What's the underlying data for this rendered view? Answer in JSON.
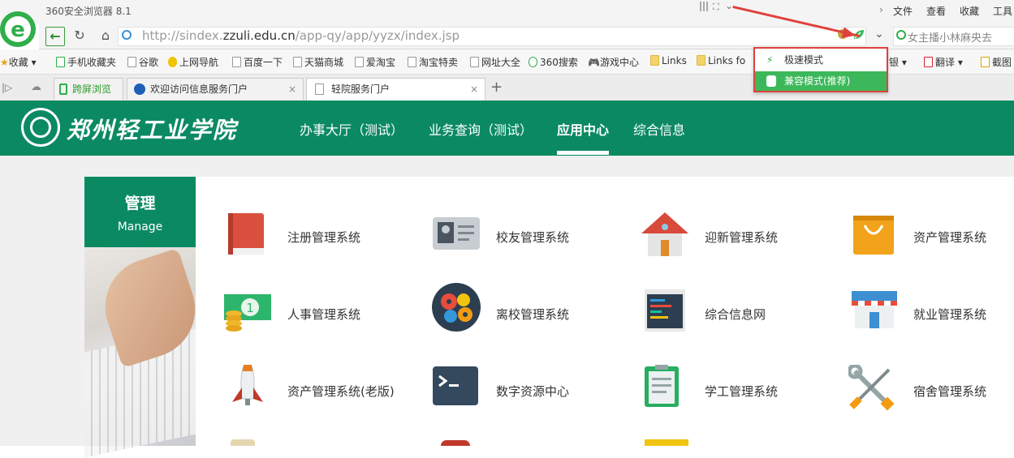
{
  "browser": {
    "title": "360安全浏览器 8.1",
    "menu": [
      "文件",
      "查看",
      "收藏",
      "工具"
    ],
    "url_prefix": "http://sindex.",
    "url_domain": "zzuli.edu.cn",
    "url_path": "/app-qy/app/yyzx/index.jsp",
    "search_placeholder": "女主播小林麻央去",
    "bookmarks": [
      "收藏",
      "手机收藏夹",
      "谷歌",
      "上网导航",
      "百度一下",
      "天猫商城",
      "爱淘宝",
      "淘宝特卖",
      "网址大全",
      "360搜索",
      "游戏中心",
      "Links",
      "Links fo"
    ],
    "bookmarks_right": [
      "银",
      "翻译",
      "截图"
    ],
    "tabs": [
      {
        "label": "跨屏浏览"
      },
      {
        "label": "欢迎访问信息服务门户"
      },
      {
        "label": "轻院服务门户"
      }
    ],
    "mode_menu": {
      "fast": "极速模式",
      "compat": "兼容模式(推荐)"
    }
  },
  "site": {
    "name": "郑州轻工业学院",
    "nav": [
      "办事大厅（测试）",
      "业务查询（测试）",
      "应用中心",
      "综合信息"
    ],
    "sidebar": {
      "title": "管理",
      "subtitle": "Manage"
    },
    "apps": [
      {
        "label": "注册管理系统",
        "icon": "red-book-icon"
      },
      {
        "label": "校友管理系统",
        "icon": "id-card-icon"
      },
      {
        "label": "迎新管理系统",
        "icon": "house-icon"
      },
      {
        "label": "资产管理系统",
        "icon": "shopping-bag-icon"
      },
      {
        "label": "人事管理系统",
        "icon": "money-icon"
      },
      {
        "label": "离校管理系统",
        "icon": "gears-icon"
      },
      {
        "label": "综合信息网",
        "icon": "code-screen-icon"
      },
      {
        "label": "就业管理系统",
        "icon": "store-icon"
      },
      {
        "label": "资产管理系统(老版)",
        "icon": "rocket-icon"
      },
      {
        "label": "数字资源中心",
        "icon": "terminal-icon"
      },
      {
        "label": "学工管理系统",
        "icon": "clipboard-icon"
      },
      {
        "label": "宿舍管理系统",
        "icon": "tools-icon"
      }
    ]
  },
  "colors": {
    "brand_green": "#0b8a62",
    "highlight_red": "#e0413c",
    "popup_green": "#3cb85a"
  }
}
